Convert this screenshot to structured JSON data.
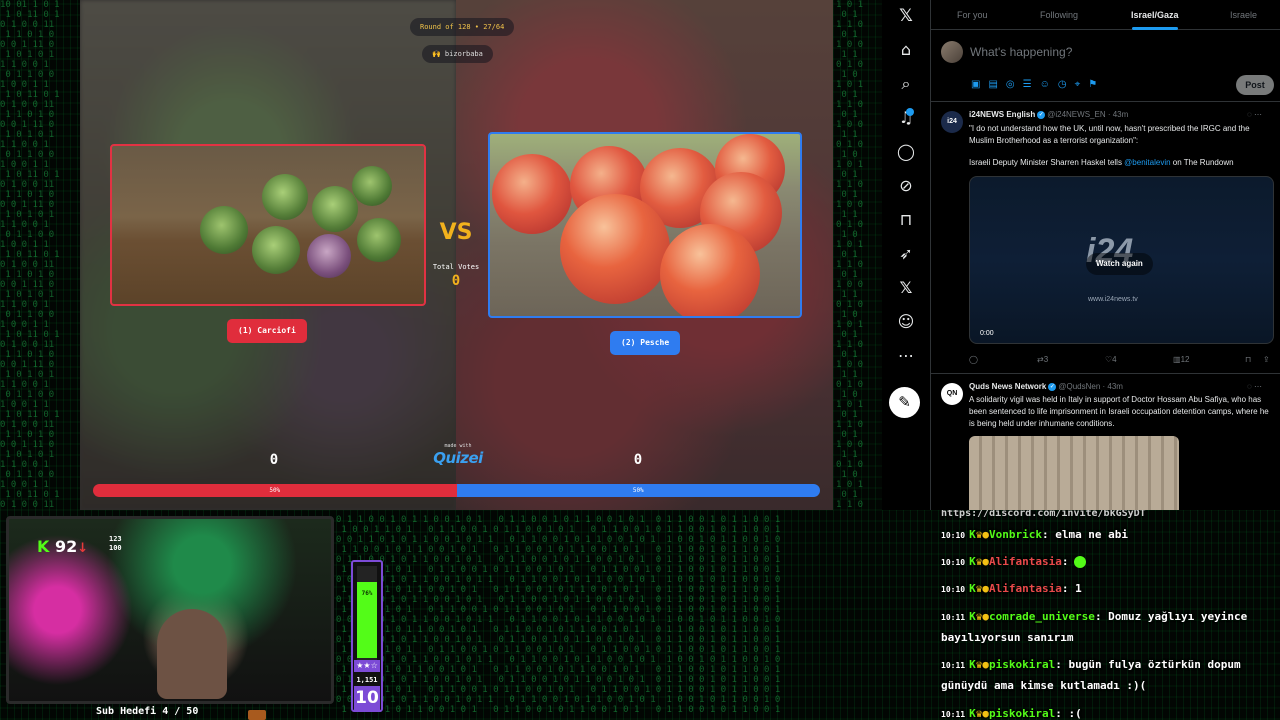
{
  "quiz": {
    "round": "Round of 128 • 27/64",
    "user": "🙌 bizorbaba",
    "vs_text": "VS",
    "total_votes_label": "Total Votes",
    "total_votes_value": "0",
    "left_choice": "(1) Carciofi",
    "right_choice": "(2) Pesche",
    "left_count": "0",
    "right_count": "0",
    "made_with": "made with",
    "logo": "Quizei",
    "left_percent": "50%",
    "right_percent": "50%",
    "left_share": 0.5,
    "right_share": 0.5,
    "colors": {
      "left": "#e02d3c",
      "right": "#2f7cf0",
      "accent": "#f2b21d"
    }
  },
  "x_nav": {
    "icons": [
      "x-logo-icon",
      "home-icon",
      "search-icon",
      "notifications-icon",
      "messages-icon",
      "grok-icon",
      "bookmarks-icon",
      "rocket-icon",
      "premium-x-icon",
      "profile-icon",
      "more-icon",
      "post-quill-icon"
    ]
  },
  "x_feed": {
    "tabs": [
      "For you",
      "Following",
      "Israel/Gaza",
      "Israele"
    ],
    "active_tab": "Israel/Gaza",
    "compose_placeholder": "What's happening?",
    "post_button": "Post",
    "tweets": [
      {
        "name": "i24NEWS English",
        "handle": "@i24NEWS_EN · 43m",
        "text1": "\"I do not understand how the UK, until now, hasn't prescribed the IRGC and the Muslim Brotherhood as a terrorist organization\":",
        "text2_pre": "Israeli Deputy Minister Sharren Haskel tells ",
        "text2_mention": "@benitalevin",
        "text2_post": " on The Rundown",
        "video_logo": "i24",
        "watch_again": "Watch again",
        "video_url": "www.i24news.tv",
        "video_time": "0:00",
        "retweets": "3",
        "likes": "4",
        "views": "12"
      },
      {
        "name": "Quds News Network",
        "handle": "@QudsNen · 43m",
        "text": "A solidarity vigil was held in Italy in support of Doctor Hossam Abu Safiya, who has been sentenced to life imprisonment in Israeli occupation detention camps, where he is being held under inhumane conditions."
      }
    ]
  },
  "stream": {
    "score": "92",
    "stat_top": "123",
    "stat_bottom": "100",
    "sub_goal": "Sub Hedefi 4 / 50",
    "meter_percent": "76%",
    "meter_fraction": 0.76,
    "meter_count": "1,151",
    "meter_level": "10",
    "meter_stars": "★★☆"
  },
  "chat": {
    "top_partial": "https://discord.com/invite/bkGSyDT",
    "messages": [
      {
        "time": "10:10",
        "user": "Vonbrick",
        "user_color": "green",
        "text": ": elma ne abi"
      },
      {
        "time": "10:10",
        "user": "Alifantasia",
        "user_color": "red",
        "text": ":"
      },
      {
        "time": "10:10",
        "user": "Alifantasia",
        "user_color": "red",
        "text": ": 1"
      },
      {
        "time": "10:11",
        "user": "comrade_universe",
        "user_color": "green",
        "text": ": Domuz yağlıyı yeyince bayılıyorsun sanırım"
      },
      {
        "time": "10:11",
        "user": "piskokiral",
        "user_color": "green",
        "text": ": bugün fulya öztürkün dopum günüydü ama kimse kutlamadı :)("
      },
      {
        "time": "10:11",
        "user": "piskokiral",
        "user_color": "green",
        "text": ": :("
      }
    ]
  }
}
